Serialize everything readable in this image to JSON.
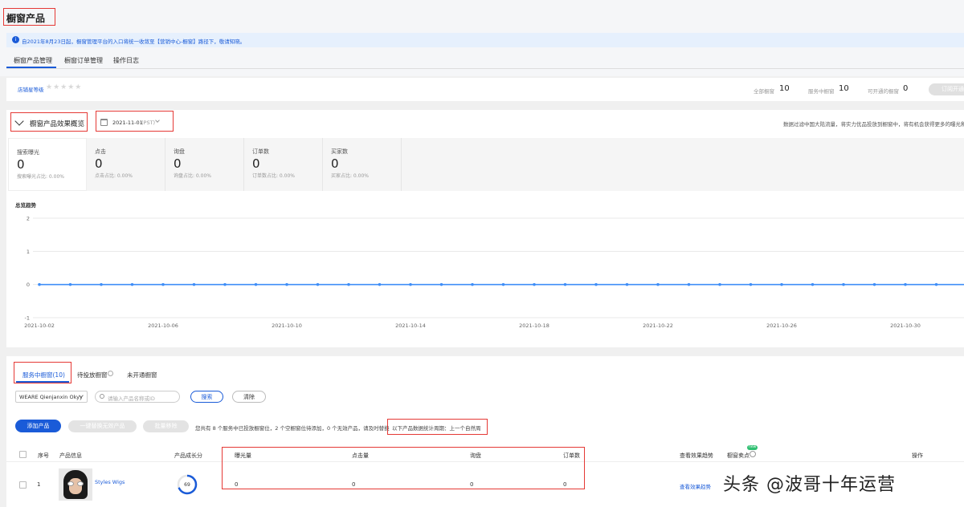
{
  "page_title": "橱窗产品",
  "notice": {
    "text": "自2021年8月23日起，橱窗管理平台的入口将统一收敛至【营销中心-橱窗】路径下，敬请知晓。"
  },
  "tabs": [
    {
      "label": "橱窗产品管理",
      "active": true
    },
    {
      "label": "橱窗订单管理",
      "active": false
    },
    {
      "label": "操作日志",
      "active": false
    }
  ],
  "shop_level": {
    "label": "店铺星等级",
    "stars": 0,
    "stars_glyph": "★★★★★"
  },
  "counts": [
    {
      "label": "全部橱窗",
      "value": "10"
    },
    {
      "label": "服务中橱窗",
      "value": "10"
    },
    {
      "label": "可开通的橱窗",
      "value": "0"
    }
  ],
  "open_button": "订阅开通",
  "overview": {
    "title": "橱窗产品效果概览",
    "date": "2021-11-01",
    "timezone": "(PST)",
    "note": "数据过滤中国大陆流量，将实力优品投放到橱窗中，将有机会获得更多的曝光和"
  },
  "kpis": [
    {
      "label": "搜索曝光",
      "value": "0",
      "sub": "搜索曝光占比: 0.00%"
    },
    {
      "label": "点击",
      "value": "0",
      "sub": "点击占比: 0.00%"
    },
    {
      "label": "询盘",
      "value": "0",
      "sub": "询盘占比: 0.00%"
    },
    {
      "label": "订单数",
      "value": "0",
      "sub": "订单数占比: 0.00%"
    },
    {
      "label": "买家数",
      "value": "0",
      "sub": "买家占比: 0.00%"
    }
  ],
  "chart_data": {
    "type": "line",
    "title": "总览趋势",
    "x": [
      "2021-10-02",
      "2021-10-03",
      "2021-10-04",
      "2021-10-05",
      "2021-10-06",
      "2021-10-07",
      "2021-10-08",
      "2021-10-09",
      "2021-10-10",
      "2021-10-11",
      "2021-10-12",
      "2021-10-13",
      "2021-10-14",
      "2021-10-15",
      "2021-10-16",
      "2021-10-17",
      "2021-10-18",
      "2021-10-19",
      "2021-10-20",
      "2021-10-21",
      "2021-10-22",
      "2021-10-23",
      "2021-10-24",
      "2021-10-25",
      "2021-10-26",
      "2021-10-27",
      "2021-10-28",
      "2021-10-29",
      "2021-10-30",
      "2021-10-31",
      "2021-11-01"
    ],
    "x_tick_labels": [
      "2021-10-02",
      "2021-10-06",
      "2021-10-10",
      "2021-10-14",
      "2021-10-18",
      "2021-10-22",
      "2021-10-26",
      "2021-10-30"
    ],
    "series": [
      {
        "values": [
          0,
          0,
          0,
          0,
          0,
          0,
          0,
          0,
          0,
          0,
          0,
          0,
          0,
          0,
          0,
          0,
          0,
          0,
          0,
          0,
          0,
          0,
          0,
          0,
          0,
          0,
          0,
          0,
          0,
          0,
          0
        ],
        "color": "#3f8ef7"
      }
    ],
    "y_ticks": [
      "2",
      "1",
      "0",
      "-1"
    ],
    "ylim": [
      -1,
      2
    ],
    "grid": true
  },
  "sub_tabs": [
    {
      "label": "服务中橱窗(10)",
      "active": true
    },
    {
      "label": "待投放橱窗",
      "active": false
    },
    {
      "label": "未开通橱窗",
      "active": false
    }
  ],
  "filters": {
    "account": "WEARE Qienjanxin Okyy",
    "search_placeholder": "请输入产品名称或ID",
    "search_button": "搜索",
    "clear_button": "清除"
  },
  "actions": {
    "add_product": "添加产品",
    "batch_replace": "一键替换无效产品",
    "batch_remove": "批量移除",
    "summary": "您共有 8 个服务中已投放橱窗位，2 个空橱窗位待添加，0 个无效产品，请及时替换",
    "cycle_note": "以下产品数据统计周期：上一个自然周"
  },
  "table": {
    "headers": {
      "index": "序号",
      "product": "产品信息",
      "growth": "产品成长分",
      "exposure": "曝光量",
      "clicks": "点击量",
      "inquiries": "询盘",
      "orders": "订单数",
      "trend": "查看效果趋势",
      "selling_point": "橱窗卖点",
      "new_badge": "new",
      "operation": "操作"
    },
    "rows": [
      {
        "index": "1",
        "product_name": "Styles Wigs",
        "growth_score": "69",
        "growth_fraction": 0.69,
        "exposure": "0",
        "clicks": "0",
        "inquiries": "0",
        "orders": "0",
        "trend_link": "查看效果趋势"
      }
    ]
  },
  "watermark": "头条 @波哥十年运营",
  "colors": {
    "primary": "#1a5bd8",
    "highlight": "#e53935",
    "line": "#3f8ef7"
  }
}
